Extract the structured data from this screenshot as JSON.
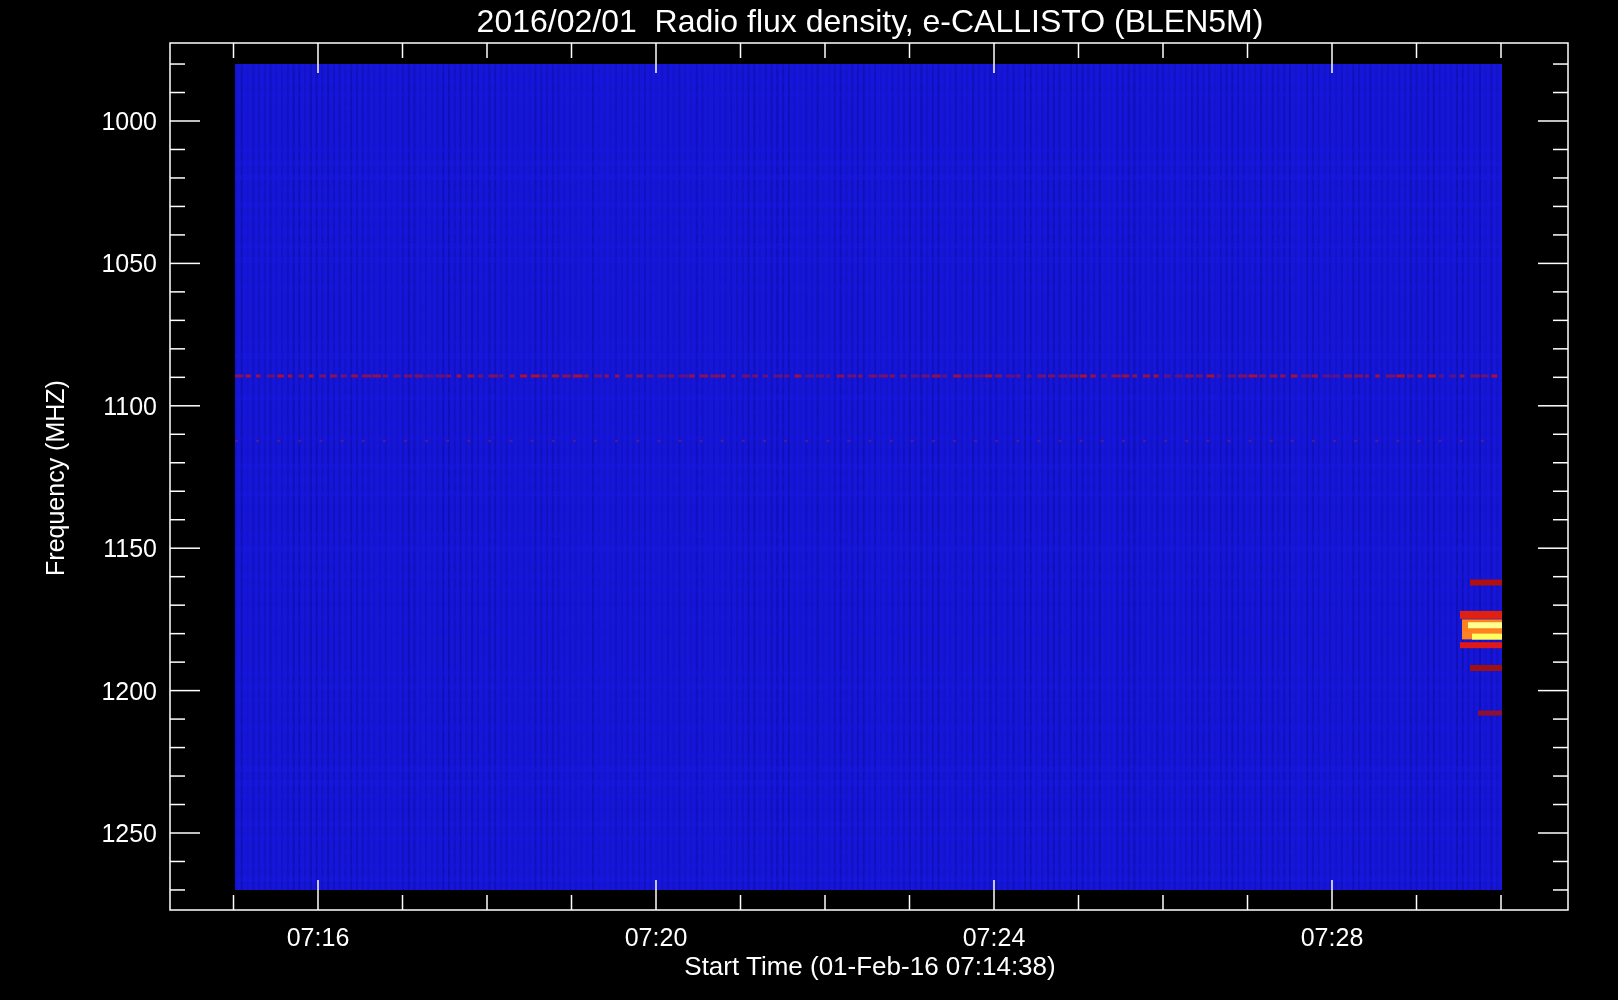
{
  "title": "2016/02/01  Radio flux density, e-CALLISTO (BLEN5M)",
  "y_axis": {
    "label": "Frequency (MHZ)",
    "ticks": [
      "1000",
      "1050",
      "1100",
      "1150",
      "1200",
      "1250"
    ]
  },
  "x_axis": {
    "label": "Start Time (01-Feb-16 07:14:38)",
    "ticks": [
      "07:16",
      "07:20",
      "07:24",
      "07:28"
    ]
  }
}
